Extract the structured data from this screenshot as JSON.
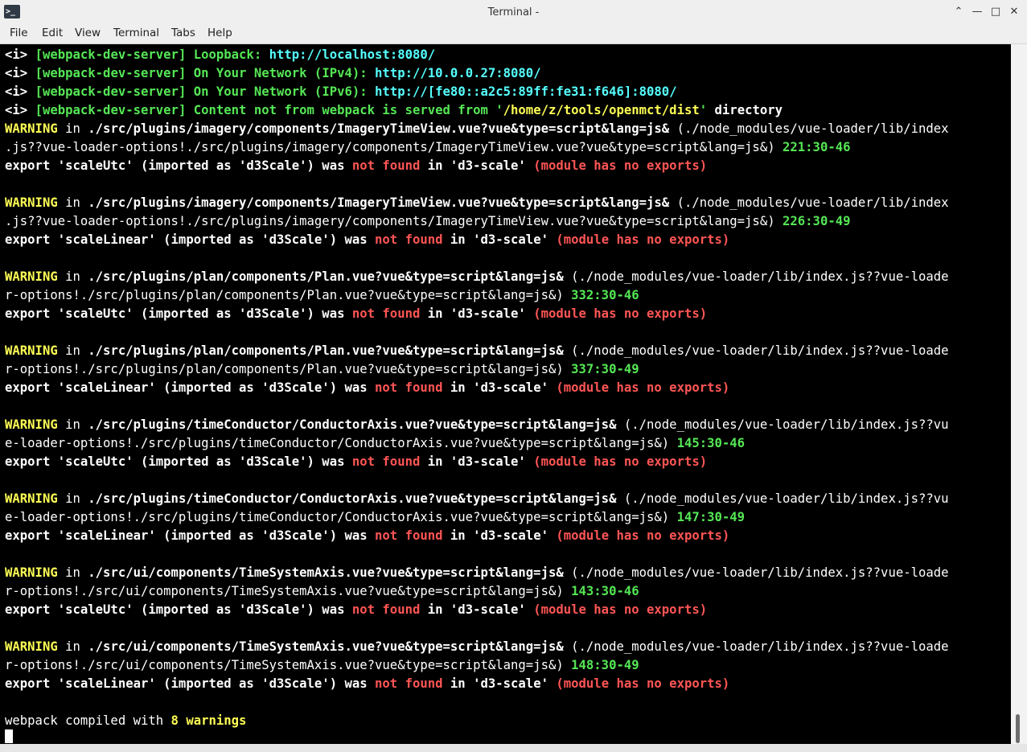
{
  "window": {
    "title": "Terminal -"
  },
  "icons": {
    "terminal": "terminal-icon",
    "minimize_up": "chevron-up-icon",
    "minimize": "minimize-icon",
    "maximize": "maximize-icon",
    "close": "close-icon"
  },
  "menu": {
    "file": "File",
    "edit": "Edit",
    "view": "View",
    "terminal": "Terminal",
    "tabs": "Tabs",
    "help": "Help"
  },
  "terminal": {
    "l1": {
      "a": "<i> ",
      "b": "[webpack-dev-server] Loopback: ",
      "c": "http://localhost:8080/"
    },
    "l2": {
      "a": "<i> ",
      "b": "[webpack-dev-server] On Your Network (IPv4): ",
      "c": "http://10.0.0.27:8080/"
    },
    "l3": {
      "a": "<i> ",
      "b": "[webpack-dev-server] On Your Network (IPv6): ",
      "c": "http://[fe80::a2c5:89ff:fe31:f646]:8080/"
    },
    "l4": {
      "a": "<i> ",
      "b": "[webpack-dev-server] Content not from webpack is served from '",
      "c": "/home/z/tools/openmct/dist",
      "d": "' ",
      "e": "directory"
    },
    "w1": {
      "warn": "WARNING",
      "in": " in ",
      "path": "./src/plugins/imagery/components/ImageryTimeView.vue?vue&type=script&lang=js&",
      "rest": " (./node_modules/vue-loader/lib/index",
      "cont": ".js??vue-loader-options!./src/plugins/imagery/components/ImageryTimeView.vue?vue&type=script&lang=js&) ",
      "pos": "221:30-46",
      "exp1": "export 'scaleUtc' (imported as 'd3Scale') was ",
      "nf": "not found",
      "exp2": " in 'd3-scale' ",
      "noexp": "(module has no exports)"
    },
    "w2": {
      "warn": "WARNING",
      "in": " in ",
      "path": "./src/plugins/imagery/components/ImageryTimeView.vue?vue&type=script&lang=js&",
      "rest": " (./node_modules/vue-loader/lib/index",
      "cont": ".js??vue-loader-options!./src/plugins/imagery/components/ImageryTimeView.vue?vue&type=script&lang=js&) ",
      "pos": "226:30-49",
      "exp1": "export 'scaleLinear' (imported as 'd3Scale') was ",
      "nf": "not found",
      "exp2": " in 'd3-scale' ",
      "noexp": "(module has no exports)"
    },
    "w3": {
      "warn": "WARNING",
      "in": " in ",
      "path": "./src/plugins/plan/components/Plan.vue?vue&type=script&lang=js&",
      "rest": " (./node_modules/vue-loader/lib/index.js??vue-loade",
      "cont": "r-options!./src/plugins/plan/components/Plan.vue?vue&type=script&lang=js&) ",
      "pos": "332:30-46",
      "exp1": "export 'scaleUtc' (imported as 'd3Scale') was ",
      "nf": "not found",
      "exp2": " in 'd3-scale' ",
      "noexp": "(module has no exports)"
    },
    "w4": {
      "warn": "WARNING",
      "in": " in ",
      "path": "./src/plugins/plan/components/Plan.vue?vue&type=script&lang=js&",
      "rest": " (./node_modules/vue-loader/lib/index.js??vue-loade",
      "cont": "r-options!./src/plugins/plan/components/Plan.vue?vue&type=script&lang=js&) ",
      "pos": "337:30-49",
      "exp1": "export 'scaleLinear' (imported as 'd3Scale') was ",
      "nf": "not found",
      "exp2": " in 'd3-scale' ",
      "noexp": "(module has no exports)"
    },
    "w5": {
      "warn": "WARNING",
      "in": " in ",
      "path": "./src/plugins/timeConductor/ConductorAxis.vue?vue&type=script&lang=js&",
      "rest": " (./node_modules/vue-loader/lib/index.js??vu",
      "cont": "e-loader-options!./src/plugins/timeConductor/ConductorAxis.vue?vue&type=script&lang=js&) ",
      "pos": "145:30-46",
      "exp1": "export 'scaleUtc' (imported as 'd3Scale') was ",
      "nf": "not found",
      "exp2": " in 'd3-scale' ",
      "noexp": "(module has no exports)"
    },
    "w6": {
      "warn": "WARNING",
      "in": " in ",
      "path": "./src/plugins/timeConductor/ConductorAxis.vue?vue&type=script&lang=js&",
      "rest": " (./node_modules/vue-loader/lib/index.js??vu",
      "cont": "e-loader-options!./src/plugins/timeConductor/ConductorAxis.vue?vue&type=script&lang=js&) ",
      "pos": "147:30-49",
      "exp1": "export 'scaleLinear' (imported as 'd3Scale') was ",
      "nf": "not found",
      "exp2": " in 'd3-scale' ",
      "noexp": "(module has no exports)"
    },
    "w7": {
      "warn": "WARNING",
      "in": " in ",
      "path": "./src/ui/components/TimeSystemAxis.vue?vue&type=script&lang=js&",
      "rest": " (./node_modules/vue-loader/lib/index.js??vue-loade",
      "cont": "r-options!./src/ui/components/TimeSystemAxis.vue?vue&type=script&lang=js&) ",
      "pos": "143:30-46",
      "exp1": "export 'scaleUtc' (imported as 'd3Scale') was ",
      "nf": "not found",
      "exp2": " in 'd3-scale' ",
      "noexp": "(module has no exports)"
    },
    "w8": {
      "warn": "WARNING",
      "in": " in ",
      "path": "./src/ui/components/TimeSystemAxis.vue?vue&type=script&lang=js&",
      "rest": " (./node_modules/vue-loader/lib/index.js??vue-loade",
      "cont": "r-options!./src/ui/components/TimeSystemAxis.vue?vue&type=script&lang=js&) ",
      "pos": "148:30-49",
      "exp1": "export 'scaleLinear' (imported as 'd3Scale') was ",
      "nf": "not found",
      "exp2": " in 'd3-scale' ",
      "noexp": "(module has no exports)"
    },
    "summary": {
      "a": "webpack compiled with ",
      "b": "8 warnings"
    }
  },
  "colors": {
    "background": "#000000",
    "green": "#55e655",
    "cyan": "#55ffff",
    "yellow": "#ffff55",
    "red": "#ff5555"
  }
}
